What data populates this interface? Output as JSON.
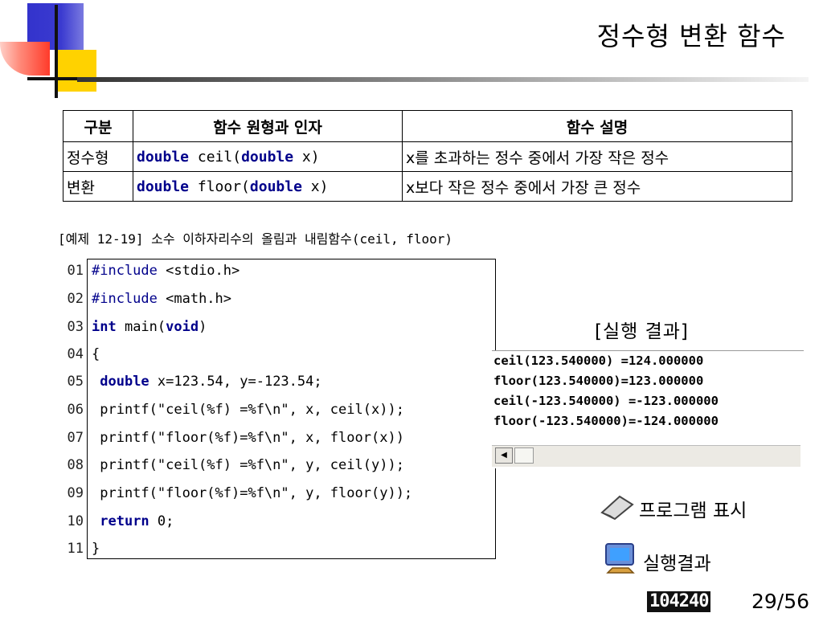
{
  "page": {
    "title": "정수형 변환 함수"
  },
  "table": {
    "headers": [
      "구분",
      "함수 원형과 인자",
      "함수 설명"
    ],
    "category_line1": "정수형",
    "category_line2": "변환",
    "rows": [
      {
        "ret_type": "double",
        "func": " ceil(",
        "param_type": "double",
        "param": " x)",
        "desc": "x를 초과하는 정수 중에서 가장 작은 정수"
      },
      {
        "ret_type": "double",
        "func": " floor(",
        "param_type": "double",
        "param": " x)",
        "desc": "x보다 작은 정수 중에서 가장 큰 정수"
      }
    ]
  },
  "example": {
    "title": "[예제 12-19] 소수 이하자리수의 올림과 내림함수(ceil, floor)"
  },
  "code": {
    "line_numbers": [
      "01",
      "02",
      "03",
      "04",
      "05",
      "06",
      "07",
      "08",
      "09",
      "10",
      "11"
    ],
    "include1": {
      "directive": "#include",
      "rest": " <stdio.h>"
    },
    "include2": {
      "directive": "#include",
      "rest": " <math.h>"
    },
    "main": {
      "kw1": "int",
      "mid": " main(",
      "kw2": "void",
      "end": ")"
    },
    "open_brace": "{",
    "decl": {
      "indent": " ",
      "kw": "double",
      "rest": " x=123.54, y=-123.54;"
    },
    "printf1": " printf(\"ceil(%f) =%f\\n\", x, ceil(x));",
    "printf2": " printf(\"floor(%f)=%f\\n\", x, floor(x))",
    "printf3": " printf(\"ceil(%f) =%f\\n\", y, ceil(y));",
    "printf4": " printf(\"floor(%f)=%f\\n\", y, floor(y));",
    "ret": {
      "indent": " ",
      "kw": "return",
      "rest": " 0;"
    },
    "close_brace": "}"
  },
  "result": {
    "label": "[실행 결과]",
    "lines": [
      "ceil(123.540000) =124.000000",
      "floor(123.540000)=123.000000",
      "ceil(-123.540000) =-123.000000",
      "floor(-123.540000)=-124.000000"
    ]
  },
  "legend": {
    "program_label": "프로그램 표시",
    "result_label": "실행결과",
    "program_icon": "pencil-icon",
    "result_icon": "monitor-icon"
  },
  "footer": {
    "badge": "104240",
    "page": "29/56"
  },
  "colors": {
    "keyword": "#00008b",
    "logo_blue": "#3333cc",
    "logo_yellow": "#ffd200",
    "logo_red": "#ff3b2a"
  }
}
